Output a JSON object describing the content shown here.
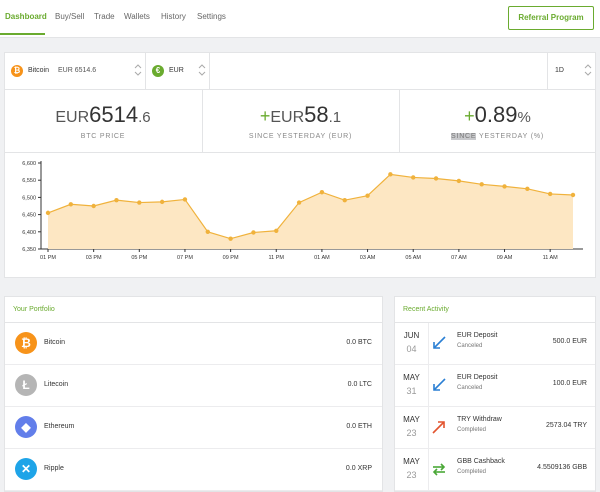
{
  "nav": {
    "items": [
      "Dashboard",
      "Buy/Sell",
      "Trade",
      "Wallets",
      "History",
      "Settings"
    ],
    "active": "Dashboard",
    "referral_label": "Referral Program"
  },
  "selectors": {
    "coin": {
      "name": "Bitcoin",
      "price": "EUR 6514.6",
      "icon": "bitcoin-icon"
    },
    "currency": {
      "name": "EUR",
      "icon": "euro-icon"
    },
    "period": "1D"
  },
  "stats": {
    "price": {
      "prefix": "EUR",
      "whole": "6514",
      "decimal": ".6",
      "label": "BTC PRICE"
    },
    "change": {
      "sign": "+",
      "prefix": "EUR",
      "whole": "58",
      "decimal": ".1",
      "label": "SINCE YESTERDAY (EUR)"
    },
    "percent": {
      "sign": "+",
      "whole": "0.89",
      "suffix": "%",
      "label_highlight": "SINCE",
      "label_rest": " YESTERDAY (%)"
    }
  },
  "chart_data": {
    "type": "area",
    "x": [
      "01 PM",
      "02 PM",
      "03 PM",
      "04 PM",
      "05 PM",
      "06 PM",
      "07 PM",
      "08 PM",
      "09 PM",
      "10 PM",
      "11 PM",
      "12 AM",
      "01 AM",
      "02 AM",
      "03 AM",
      "04 AM",
      "05 AM",
      "06 AM",
      "07 AM",
      "08 AM",
      "09 AM",
      "10 AM",
      "11 AM",
      "12 PM"
    ],
    "values": [
      6455,
      6480,
      6475,
      6492,
      6485,
      6487,
      6494,
      6400,
      6380,
      6398,
      6403,
      6485,
      6515,
      6492,
      6505,
      6567,
      6558,
      6555,
      6548,
      6538,
      6532,
      6525,
      6510,
      6507
    ],
    "xticks": [
      "01 PM",
      "03 PM",
      "05 PM",
      "07 PM",
      "09 PM",
      "11 PM",
      "01 AM",
      "03 AM",
      "05 AM",
      "07 AM",
      "09 AM",
      "11 AM"
    ],
    "yticks": [
      6350,
      6400,
      6450,
      6500,
      6550,
      6600
    ],
    "ytick_labels": [
      "6,350",
      "6,400",
      "6,450",
      "6,500",
      "6,550",
      "6,600"
    ],
    "ylim": [
      6350,
      6600
    ],
    "title": "",
    "xlabel": "",
    "ylabel": "",
    "line_color": "#f0b23c",
    "fill_color": "#fde7c3"
  },
  "portfolio": {
    "title": "Your Portfolio",
    "items": [
      {
        "name": "Bitcoin",
        "balance": "0.0 BTC",
        "icon": "bitcoin-icon",
        "color": "#f7931a",
        "glyph": "₿"
      },
      {
        "name": "Litecoin",
        "balance": "0.0 LTC",
        "icon": "litecoin-icon",
        "color": "#b5b5b5",
        "glyph": "Ł"
      },
      {
        "name": "Ethereum",
        "balance": "0.0 ETH",
        "icon": "ethereum-icon",
        "color": "#627eea",
        "glyph": "◆"
      },
      {
        "name": "Ripple",
        "balance": "0.0 XRP",
        "icon": "ripple-icon",
        "color": "#1ea4e8",
        "glyph": "✕"
      }
    ]
  },
  "activity": {
    "title": "Recent Activity",
    "items": [
      {
        "month": "JUN",
        "day": "04",
        "title": "EUR Deposit",
        "status": "Canceled",
        "amount": "500.0 EUR",
        "icon": "deposit-arrow-icon",
        "color": "#2a7fd4"
      },
      {
        "month": "MAY",
        "day": "31",
        "title": "EUR Deposit",
        "status": "Canceled",
        "amount": "100.0 EUR",
        "icon": "deposit-arrow-icon",
        "color": "#2a7fd4"
      },
      {
        "month": "MAY",
        "day": "23",
        "title": "TRY Withdraw",
        "status": "Completed",
        "amount": "2573.04 TRY",
        "icon": "withdraw-arrow-icon",
        "color": "#e2542f"
      },
      {
        "month": "MAY",
        "day": "23",
        "title": "GBB Cashback",
        "status": "Completed",
        "amount": "4.5509136 GBB",
        "icon": "cashback-arrows-icon",
        "color": "#4aa837"
      }
    ]
  }
}
